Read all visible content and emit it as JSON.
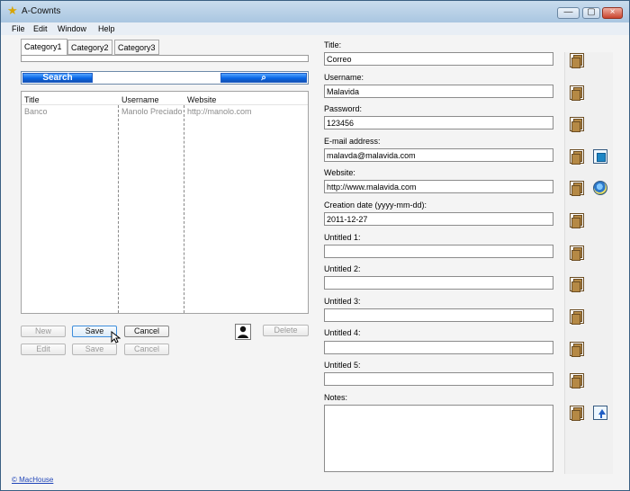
{
  "window": {
    "title": "A-Cownts",
    "minimize_icon": "minimize-icon",
    "maximize_icon": "maximize-icon",
    "close_icon": "close-icon"
  },
  "menu": [
    "File",
    "Edit",
    "Window",
    "Help"
  ],
  "tabs": [
    "Category1",
    "Category2",
    "Category3"
  ],
  "search": {
    "button_label": "Search",
    "value": "",
    "icon": "search-icon"
  },
  "table": {
    "columns": [
      "Title",
      "Username",
      "Website"
    ],
    "rows": [
      [
        "Banco",
        "Manolo Preciado",
        "http://manolo.com"
      ]
    ]
  },
  "actions": {
    "new": "New",
    "save": "Save",
    "cancel": "Cancel",
    "edit": "Edit",
    "save_secondary": "Save",
    "cancel_secondary": "Cancel",
    "delete": "Delete"
  },
  "form": {
    "title_label": "Title:",
    "title_value": "Correo",
    "username_label": "Username:",
    "username_value": "Malavida",
    "password_label": "Password:",
    "password_value": "123456",
    "email_label": "E-mail address:",
    "email_value": "malavda@malavida.com",
    "website_label": "Website:",
    "website_value": "http://www.malavida.com",
    "creation_date_label": "Creation date (yyyy-mm-dd):",
    "creation_date_value": "2011-12-27",
    "untitled1_label": "Untitled 1:",
    "untitled2_label": "Untitled 2:",
    "untitled3_label": "Untitled 3:",
    "untitled4_label": "Untitled 4:",
    "untitled5_label": "Untitled 5:",
    "notes_label": "Notes:"
  },
  "footer": {
    "link": "© MacHouse"
  },
  "colors": {
    "selected_button": "#dcebf8",
    "search_blue": "#0866e6"
  }
}
